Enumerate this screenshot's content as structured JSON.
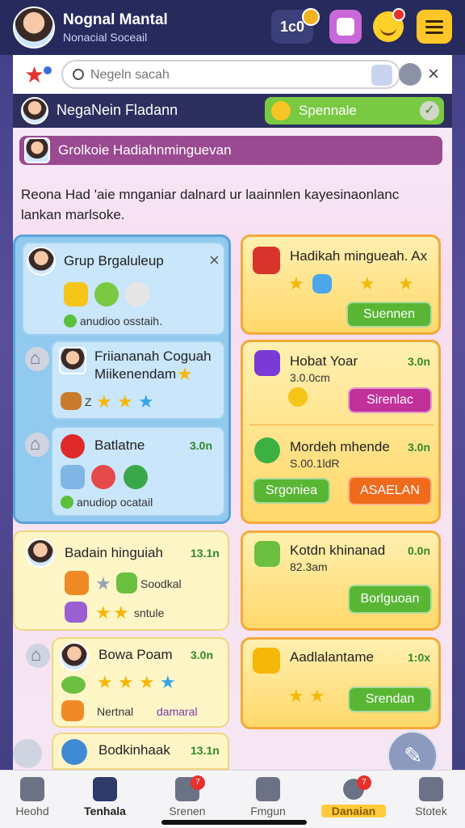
{
  "header": {
    "title": "Nognal Mantal",
    "subtitle": "Nonacial Soceail",
    "counter": "1c0",
    "colors": {
      "bar": "#262a5c",
      "accent": "#ffc627"
    }
  },
  "search": {
    "placeholder": "Negeln sacah",
    "close_label": "×"
  },
  "profile_row": {
    "name": "NegaNein Fladann",
    "pill_label": "Spennale",
    "pill_check": "✓"
  },
  "group_banner": {
    "label": "Grolkoie Hadiahnminguevan"
  },
  "description": "Reona Had 'aie mnganiar dalnard ur laainnlen kayesinaonlanc lankan marlsoke.",
  "left": {
    "group_card": {
      "title": "Grup Brgaluleup",
      "close": "×",
      "status": "anudioo osstaih."
    },
    "friend_card": {
      "title": "Friiananah Coguah",
      "subtitle": "Miikenendam",
      "count": "Z"
    },
    "badge_card": {
      "title": "Batlatne",
      "value": "3.0n",
      "status": "anudiop ocatail"
    },
    "hingu_card": {
      "title": "Badain hinguiah",
      "value": "13.1n",
      "line1": "Soodkal",
      "line2": "sntule"
    },
    "poem_card": {
      "title": "Bowa Poam",
      "value": "3.0n",
      "line1": "Nertnal",
      "line2": "damaral"
    },
    "book_card": {
      "title": "Bodkinhaak",
      "value": "13.1n"
    }
  },
  "right": {
    "gift_card": {
      "title": "Hadikah mingueah. Ax",
      "button": "Suennen"
    },
    "year_card": {
      "title": "Hobat Yoar",
      "value": "3.0n",
      "sub": "3.0.0cm",
      "button": "Sirenlac"
    },
    "mode_card": {
      "title": "Mordeh mhende",
      "value": "3.0n",
      "sub": "S.00.1ldR",
      "button_left": "Srgoniea",
      "button_right": "ASAELAN"
    },
    "kotdn_card": {
      "title": "Kotdn khinanad",
      "value": "0.0n",
      "sub": "82.3am",
      "button": "Borlguoan"
    },
    "aad_card": {
      "title": "Aadlalantame",
      "value": "1:0x",
      "button": "Srendan"
    }
  },
  "bottom_nav": [
    {
      "label": "Heohd",
      "icon": "home-icon"
    },
    {
      "label": "Tenhala",
      "icon": "house-icon"
    },
    {
      "label": "Srenen",
      "icon": "chat-icon",
      "badge": "7"
    },
    {
      "label": "Fmgun",
      "icon": "people-icon"
    },
    {
      "label": "Danaian",
      "icon": "avatar-icon",
      "badge": "7"
    },
    {
      "label": "Stotek",
      "icon": "profile-icon"
    }
  ]
}
